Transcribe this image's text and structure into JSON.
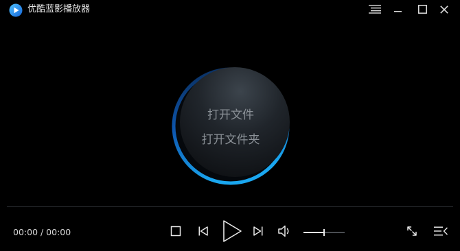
{
  "window": {
    "title": "优酷蓝影播放器"
  },
  "icons": {
    "logo": "play-logo-icon",
    "menu": "menu-icon",
    "minimize": "minimize-icon",
    "maximize": "maximize-icon",
    "close": "close-icon",
    "stop": "stop-icon",
    "previous": "previous-track-icon",
    "play": "play-icon",
    "next": "next-track-icon",
    "volume": "volume-icon",
    "fullscreen": "fullscreen-icon",
    "playlist": "playlist-icon"
  },
  "center": {
    "open_file": "打开文件",
    "open_folder": "打开文件夹"
  },
  "controls": {
    "time": "00:00 / 00:00",
    "progress": 0,
    "volume": 0.5
  },
  "colors": {
    "background": "#000000",
    "accent": "#1a8fe3",
    "text": "#e6e6e6",
    "muted_text": "#8a9096"
  }
}
